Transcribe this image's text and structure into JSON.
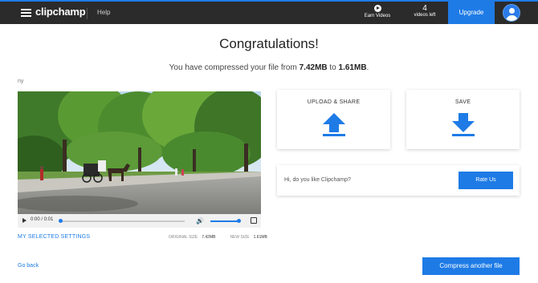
{
  "header": {
    "logo": "clipchamp",
    "help": "Help",
    "earn_videos": "Earn Videos",
    "videos_left_count": "4",
    "videos_left_label": "videos left",
    "upgrade": "Upgrade"
  },
  "main": {
    "title": "Congratulations!",
    "subtitle_prefix": "You have compressed your file from ",
    "original_size": "7.42MB",
    "subtitle_mid": " to ",
    "new_size": "1.61MB",
    "subtitle_suffix": ".",
    "filename": "ny"
  },
  "player": {
    "time": "0:00 / 0:01",
    "progress": 0.0,
    "volume": 0.9
  },
  "settings": {
    "link": "MY SELECTED SETTINGS",
    "original_label": "ORIGINAL SIZE",
    "original_value": "7.42MB",
    "new_label": "NEW SIZE",
    "new_value": "1.61MB"
  },
  "actions": {
    "upload_share": "UPLOAD & SHARE",
    "save": "SAVE",
    "rate_question": "Hi, do you like Clipchamp?",
    "rate_button": "Rate Us",
    "go_back": "Go back",
    "compress_another": "Compress another file"
  },
  "colors": {
    "accent": "#1e7be6",
    "topbar": "#2b2b2b"
  }
}
